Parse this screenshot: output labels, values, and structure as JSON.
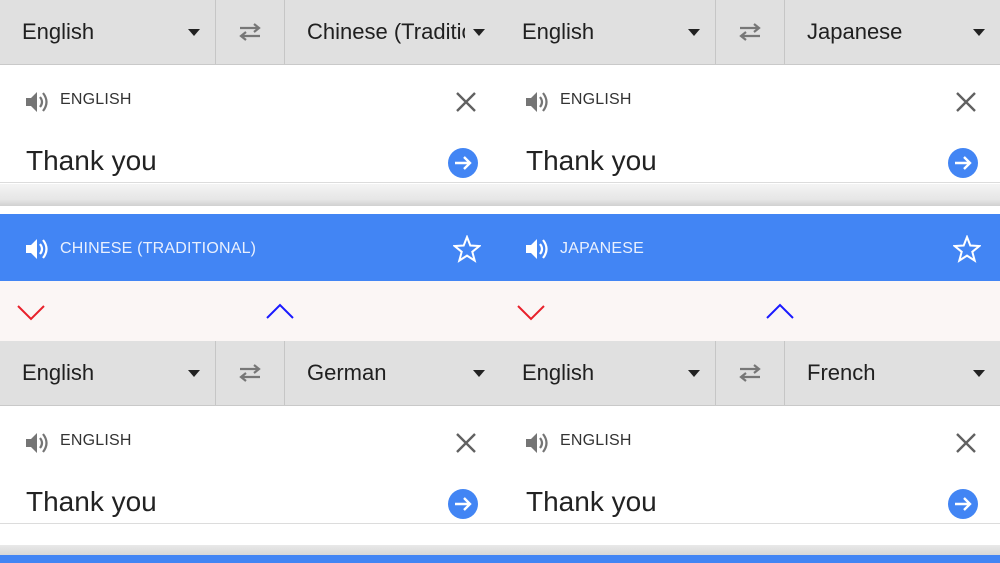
{
  "panels": [
    {
      "source_lang": "English",
      "target_lang": "Chinese (Traditional)",
      "input_label": "ENGLISH",
      "input_text": "Thank you",
      "result_label": "CHINESE (TRADITIONAL)"
    },
    {
      "source_lang": "English",
      "target_lang": "Japanese",
      "input_label": "ENGLISH",
      "input_text": "Thank you",
      "result_label": "JAPANESE"
    },
    {
      "source_lang": "English",
      "target_lang": "German",
      "input_label": "ENGLISH",
      "input_text": "Thank you"
    },
    {
      "source_lang": "English",
      "target_lang": "French",
      "input_label": "ENGLISH",
      "input_text": "Thank you"
    }
  ],
  "icons": {
    "swap": "swap-arrows-icon",
    "speaker": "speaker-icon",
    "close": "close-icon",
    "translate": "arrow-right-circle-icon",
    "star": "star-outline-icon",
    "down": "chevron-down-icon",
    "up": "chevron-up-icon"
  },
  "colors": {
    "accent": "#4285f4",
    "lang_bar": "#e0e0e0",
    "chevron_down": "#e8212b",
    "chevron_up": "#1a1aff"
  }
}
